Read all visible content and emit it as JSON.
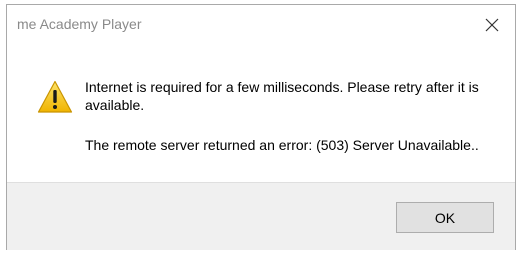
{
  "dialog": {
    "title": "me Academy Player",
    "close_icon": "close-icon",
    "warning_icon": "warning-icon",
    "message_line1": "Internet is required for a few milliseconds. Please retry after it is available.",
    "message_line2": "The remote server returned an error: (503) Server Unavailable..",
    "ok_label": "OK"
  },
  "colors": {
    "title_text": "#8a8a8a",
    "footer_bg": "#f0f0f0",
    "button_bg": "#e1e1e1",
    "button_border": "#adadad",
    "warning_yellow": "#f4c20d"
  }
}
